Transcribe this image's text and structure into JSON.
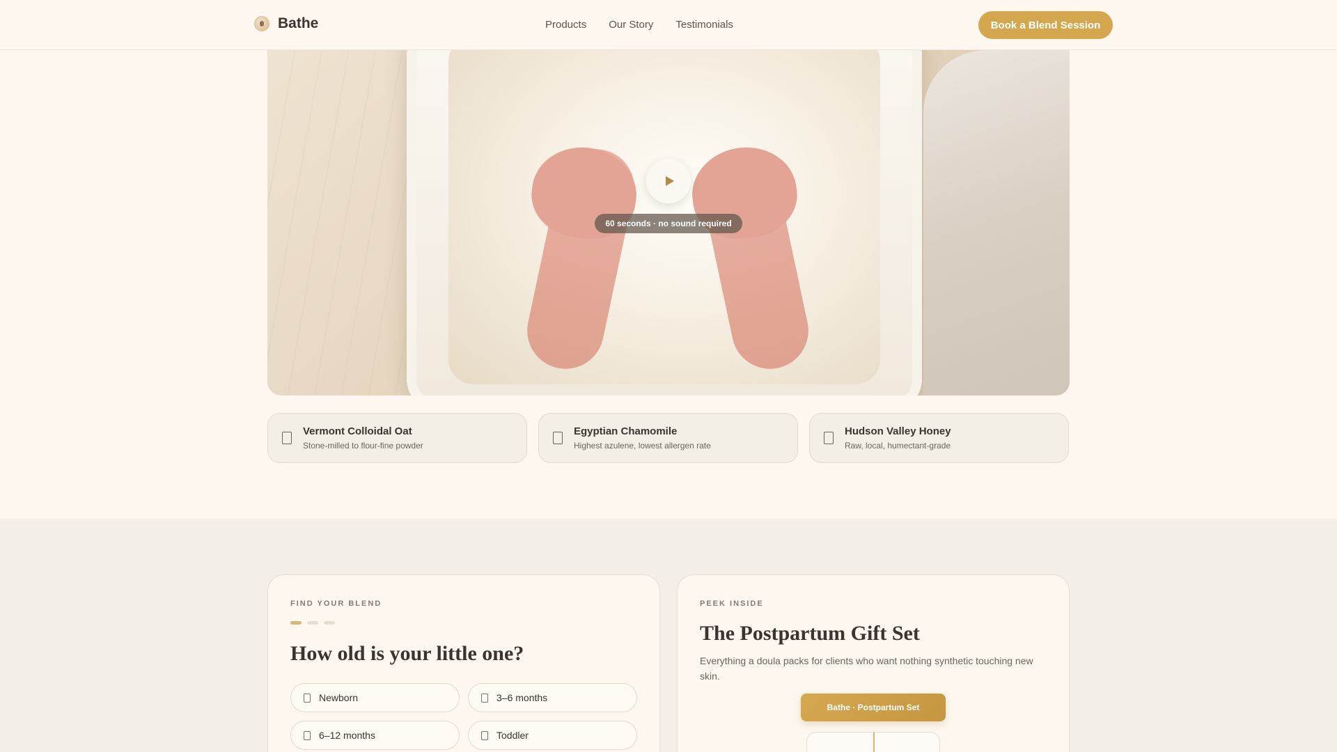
{
  "brand": {
    "name": "Bathe",
    "logo_icon": "logo-icon"
  },
  "nav": {
    "items": [
      "Products",
      "Our Story",
      "Testimonials"
    ]
  },
  "header": {
    "cta_label": "Book a Blend Session"
  },
  "colors": {
    "accent": "#d4a64d",
    "background": "#fdf7f0",
    "section_bg": "#f3efe8",
    "text": "#3a3430"
  },
  "hero": {
    "play_icon": "play-icon",
    "caption": "60 seconds · no sound required"
  },
  "ingredients": [
    {
      "icon": "leaf-icon",
      "title": "Vermont Colloidal Oat",
      "subtitle": "Stone-milled to flour-fine powder"
    },
    {
      "icon": "flower-icon",
      "title": "Egyptian Chamomile",
      "subtitle": "Highest azulene, lowest allergen rate"
    },
    {
      "icon": "honey-icon",
      "title": "Hudson Valley Honey",
      "subtitle": "Raw, local, humectant-grade"
    }
  ],
  "quiz": {
    "eyebrow": "FIND YOUR BLEND",
    "step": 1,
    "steps_total": 3,
    "question": "How old is your little one?",
    "options": [
      "Newborn",
      "3–6 months",
      "6–12 months",
      "Toddler"
    ]
  },
  "peek": {
    "eyebrow": "PEEK INSIDE",
    "title": "The Postpartum Gift Set",
    "description": "Everything a doula packs for clients who want nothing synthetic touching new skin.",
    "set_label": "Bathe · Postpartum Set"
  }
}
